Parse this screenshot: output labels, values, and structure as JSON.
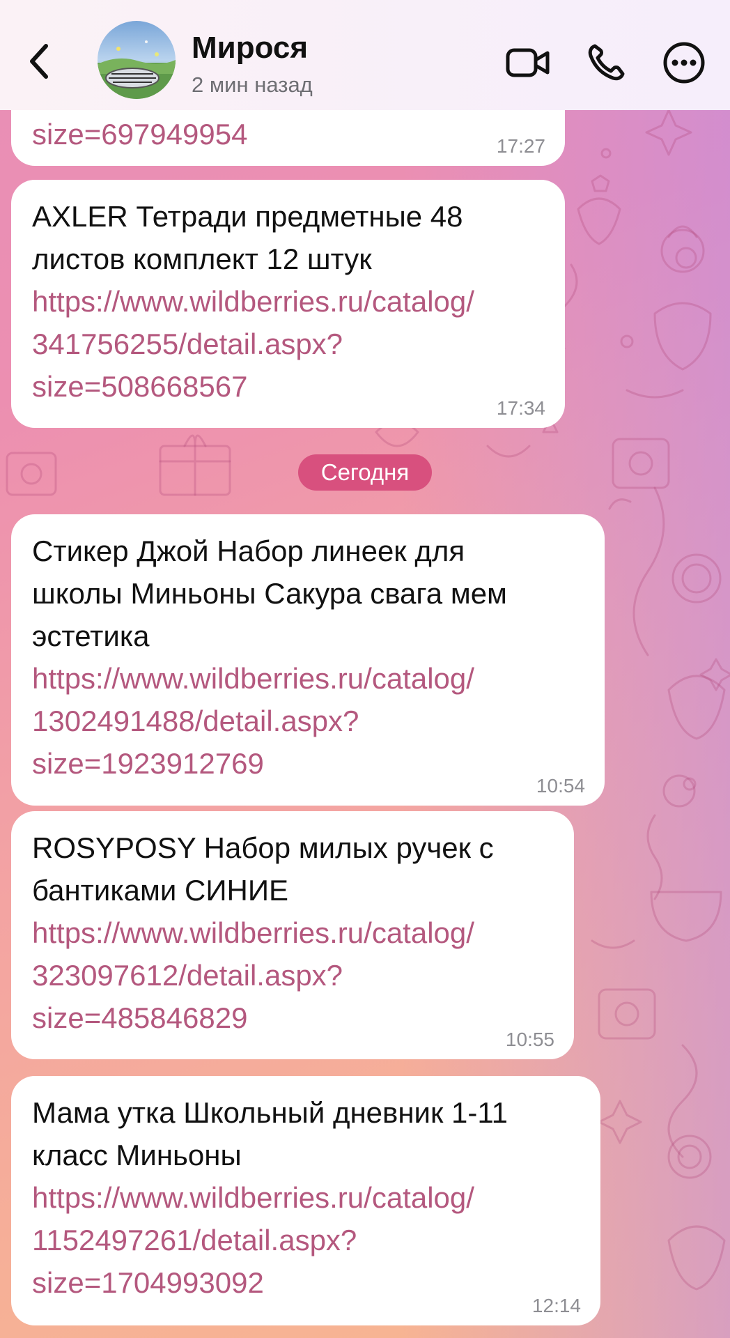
{
  "header": {
    "contact_name": "Мирося",
    "status": "2 мин назад"
  },
  "date_separator": "Сегодня",
  "messages": [
    {
      "text_lines": [],
      "link_lines": [
        "size=697949954"
      ],
      "time": "17:27"
    },
    {
      "text_lines": [
        "AXLER Тетради предметные 48",
        "листов комплект 12 штук"
      ],
      "link_lines": [
        "https://www.wildberries.ru/catalog/",
        "341756255/detail.aspx?",
        "size=508668567"
      ],
      "time": "17:34"
    },
    {
      "text_lines": [
        "Стикер Джой Набор линеек для",
        "школы Миньоны Сакура свага мем",
        "эстетика"
      ],
      "link_lines": [
        "https://www.wildberries.ru/catalog/",
        "1302491488/detail.aspx?",
        "size=1923912769"
      ],
      "time": "10:54"
    },
    {
      "text_lines": [
        "ROSYPOSY Набор милых ручек с",
        "бантиками СИНИЕ"
      ],
      "link_lines": [
        "https://www.wildberries.ru/catalog/",
        "323097612/detail.aspx?",
        "size=485846829"
      ],
      "time": "10:55"
    },
    {
      "text_lines": [
        "Мама утка Школьный дневник 1-11",
        "класс Миньоны"
      ],
      "link_lines": [
        "https://www.wildberries.ru/catalog/",
        "1152497261/detail.aspx?",
        "size=1704993092"
      ],
      "time": "12:14"
    }
  ],
  "icons": {
    "back": "chevron-left-icon",
    "avatar": "avatar",
    "video": "video-camera-icon",
    "phone": "phone-icon",
    "more": "more-icon"
  },
  "colors": {
    "link": "#b4587e",
    "date_pill": "#d8507e",
    "bubble": "#ffffff"
  }
}
